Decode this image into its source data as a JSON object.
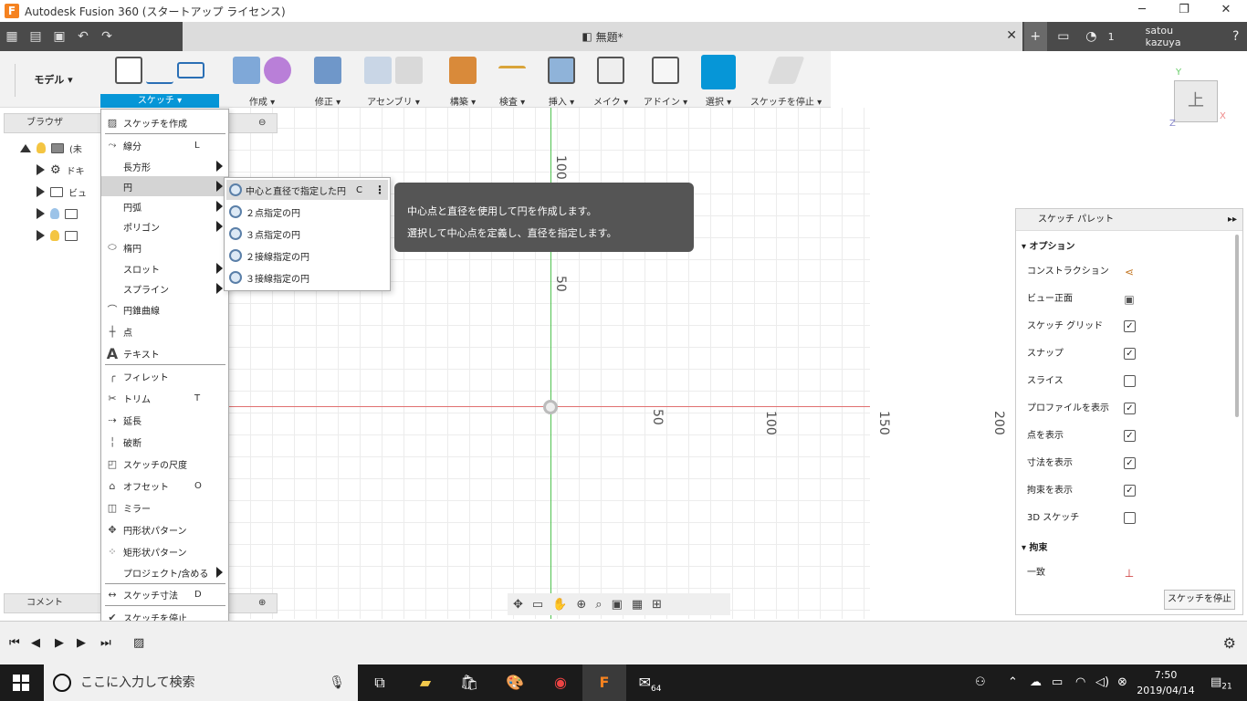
{
  "window": {
    "title": "Autodesk Fusion 360 (スタートアップ ライセンス)",
    "minimize": "─",
    "restore": "❐",
    "close": "✕"
  },
  "quickbar": {
    "doc_tab_title": "無題*",
    "tab_close": "✕",
    "add_tab": "+",
    "job_count": "1",
    "user": "satou kazuya",
    "help": "?"
  },
  "toolbar": {
    "workspace": "モデル ▾",
    "groups": [
      {
        "label": "スケッチ ▾"
      },
      {
        "label": "作成 ▾"
      },
      {
        "label": "修正 ▾"
      },
      {
        "label": "アセンブリ ▾"
      },
      {
        "label": "構築 ▾"
      },
      {
        "label": "検査 ▾"
      },
      {
        "label": "挿入 ▾"
      },
      {
        "label": "メイク ▾"
      },
      {
        "label": "アドイン ▾"
      },
      {
        "label": "選択 ▾"
      },
      {
        "label": "スケッチを停止 ▾"
      }
    ]
  },
  "browser": {
    "title": "ブラウザ",
    "items": [
      "(未",
      "ドキ",
      "ビュ",
      "",
      ""
    ]
  },
  "comments": {
    "title": "コメント"
  },
  "sketch_menu": {
    "items": [
      {
        "label": "スケッチを作成",
        "shortcut": ""
      },
      {
        "label": "線分",
        "shortcut": "L"
      },
      {
        "label": "長方形",
        "shortcut": ""
      },
      {
        "label": "円",
        "shortcut": ""
      },
      {
        "label": "円弧",
        "shortcut": ""
      },
      {
        "label": "ポリゴン",
        "shortcut": ""
      },
      {
        "label": "楕円",
        "shortcut": ""
      },
      {
        "label": "スロット",
        "shortcut": ""
      },
      {
        "label": "スプライン",
        "shortcut": ""
      },
      {
        "label": "円錐曲線",
        "shortcut": ""
      },
      {
        "label": "点",
        "shortcut": ""
      },
      {
        "label": "テキスト",
        "shortcut": ""
      },
      {
        "label": "フィレット",
        "shortcut": ""
      },
      {
        "label": "トリム",
        "shortcut": "T"
      },
      {
        "label": "延長",
        "shortcut": ""
      },
      {
        "label": "破断",
        "shortcut": ""
      },
      {
        "label": "スケッチの尺度",
        "shortcut": ""
      },
      {
        "label": "オフセット",
        "shortcut": "O"
      },
      {
        "label": "ミラー",
        "shortcut": ""
      },
      {
        "label": "円形状パターン",
        "shortcut": ""
      },
      {
        "label": "矩形状パターン",
        "shortcut": ""
      },
      {
        "label": "プロジェクト/含める",
        "shortcut": ""
      },
      {
        "label": "スケッチ寸法",
        "shortcut": "D"
      },
      {
        "label": "スケッチを停止",
        "shortcut": ""
      }
    ]
  },
  "circle_submenu": {
    "items": [
      {
        "label": "中心と直径で指定した円",
        "shortcut": "C"
      },
      {
        "label": "２点指定の円",
        "shortcut": ""
      },
      {
        "label": "３点指定の円",
        "shortcut": ""
      },
      {
        "label": "２接線指定の円",
        "shortcut": ""
      },
      {
        "label": "３接線指定の円",
        "shortcut": ""
      }
    ],
    "more": "⋮"
  },
  "tooltip": {
    "line1": "中心点と直径を使用して円を作成します。",
    "line2": "選択して中心点を定義し、直径を指定します。"
  },
  "canvas": {
    "dim_labels": [
      "100",
      "50",
      "50",
      "100",
      "150",
      "200"
    ]
  },
  "viewcube": {
    "face": "上",
    "y": "Y",
    "x": "X",
    "z": "Z"
  },
  "palette": {
    "title": "スケッチ パレット",
    "options_header": "オプション",
    "options": [
      {
        "label": "コンストラクション",
        "type": "icon"
      },
      {
        "label": "ビュー正面",
        "type": "icon"
      },
      {
        "label": "スケッチ グリッド",
        "checked": "✓"
      },
      {
        "label": "スナップ",
        "checked": "✓"
      },
      {
        "label": "スライス",
        "checked": ""
      },
      {
        "label": "プロファイルを表示",
        "checked": "✓"
      },
      {
        "label": "点を表示",
        "checked": "✓"
      },
      {
        "label": "寸法を表示",
        "checked": "✓"
      },
      {
        "label": "拘束を表示",
        "checked": "✓"
      },
      {
        "label": "3D スケッチ",
        "checked": ""
      }
    ],
    "constraints_header": "拘束",
    "constraint_first": "一致",
    "stop_button": "スケッチを停止"
  },
  "taskbar": {
    "search_placeholder": "ここに入力して検索",
    "time": "7:50",
    "date": "2019/04/14",
    "mail_badge": "64",
    "notif_count": "21"
  }
}
